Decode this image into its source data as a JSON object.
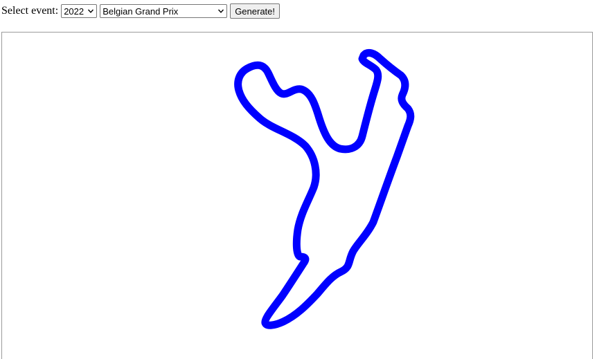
{
  "toolbar": {
    "label": "Select event:",
    "year": {
      "selected": "2022"
    },
    "event": {
      "selected": "Belgian Grand Prix"
    },
    "generate_label": "Generate!"
  },
  "track": {
    "color": "#0000ff",
    "background": "#ffffff"
  },
  "icons": {
    "dropdown": "chevron-down-icon"
  }
}
